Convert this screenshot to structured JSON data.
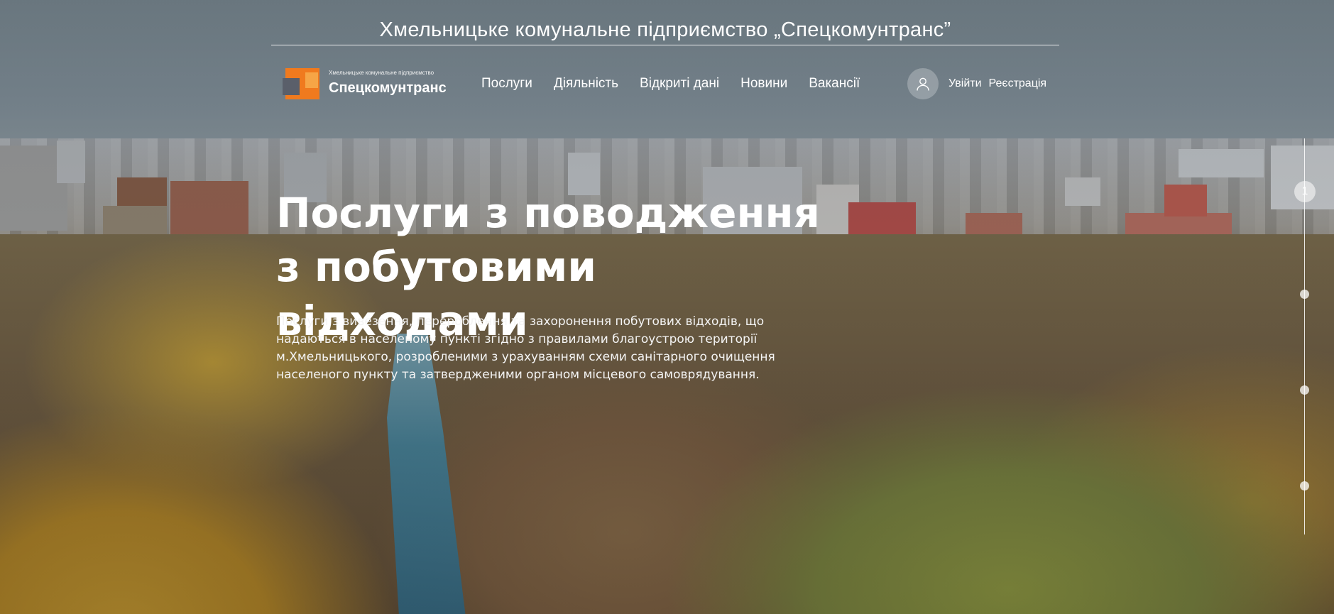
{
  "banner": {
    "title": "Хмельницьке комунальне підприємство „Спецкомунтранс”"
  },
  "logo": {
    "subtitle": "Хмельницьке комунальне підприємство",
    "name": "Спецкомунтранс",
    "colors": {
      "orange": "#f07a1e",
      "light_orange": "#f6a546",
      "gray": "#5a5f6a"
    }
  },
  "nav": {
    "items": [
      {
        "label": "Послуги"
      },
      {
        "label": "Діяльність"
      },
      {
        "label": "Відкриті дані"
      },
      {
        "label": "Новини"
      },
      {
        "label": "Вакансії"
      }
    ]
  },
  "user": {
    "icon": "user-icon",
    "login_label": "Увійти",
    "register_label": "Реєстрація"
  },
  "hero": {
    "title": "Послуги з поводження з побутовими відходами",
    "description": "Послуги з вивезення, перероблення та захоронення побутових відходів, що надаються в населеному пункті згідно з правилами благоустрою території м.Хмельницького, розробленими з урахуванням схеми санітарного очищення населеного пункту та затвердженими органом місцевого самоврядування."
  },
  "slider": {
    "active_label": "1",
    "slide_count": 4,
    "active_index": 0
  }
}
